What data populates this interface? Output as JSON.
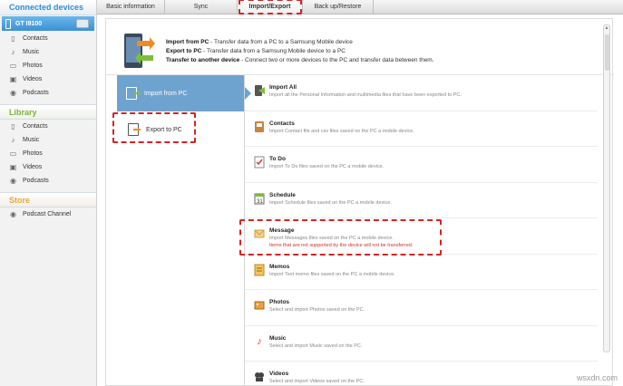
{
  "sidebar": {
    "connected_header": "Connected devices",
    "device_name": "GT I9100",
    "connected_items": [
      {
        "label": "Contacts",
        "icon": "contacts-icon"
      },
      {
        "label": "Music",
        "icon": "music-icon"
      },
      {
        "label": "Photos",
        "icon": "photos-icon"
      },
      {
        "label": "Videos",
        "icon": "videos-icon"
      },
      {
        "label": "Podcasts",
        "icon": "podcasts-icon"
      }
    ],
    "library_header": "Library",
    "library_items": [
      {
        "label": "Contacts",
        "icon": "contacts-icon"
      },
      {
        "label": "Music",
        "icon": "music-icon"
      },
      {
        "label": "Photos",
        "icon": "photos-icon"
      },
      {
        "label": "Videos",
        "icon": "videos-icon"
      },
      {
        "label": "Podcasts",
        "icon": "podcasts-icon"
      }
    ],
    "store_header": "Store",
    "store_items": [
      {
        "label": "Podcast Channel",
        "icon": "podcast-channel-icon"
      }
    ]
  },
  "tabs": [
    {
      "label": "Basic information"
    },
    {
      "label": "Sync"
    },
    {
      "label": "Import/Export",
      "active": true
    },
    {
      "label": "Back up/Restore"
    }
  ],
  "info": {
    "import_title": "Import from PC",
    "import_desc": " - Transfer data from a PC to a Samsung Mobile device",
    "export_title": "Export to PC",
    "export_desc": " - Transfer data from a Samsung Mobile device to a PC",
    "transfer_title": "Transfer to another device",
    "transfer_desc": " - Connect two or more devices to the PC and transfer data between them."
  },
  "subnav": {
    "import_label": "Import from PC",
    "export_label": "Export to PC"
  },
  "items": [
    {
      "title": "Import All",
      "desc": "Import all the Personal Information and multimedia files that have been exported to PC.",
      "icon": "import-all-icon"
    },
    {
      "title": "Contacts",
      "desc": "Import Contact file and csv files saved on the PC a mobile device.",
      "icon": "contacts-icon"
    },
    {
      "title": "To Do",
      "desc": "Import To Do files saved on the PC a mobile device.",
      "icon": "todo-icon"
    },
    {
      "title": "Schedule",
      "desc": "Import Schedule files saved on the PC a mobile device.",
      "icon": "calendar-icon"
    },
    {
      "title": "Message",
      "desc": "Import Messages files saved on the PC a mobile device.",
      "warn": "Items that are not supported by the device will not be transferred.",
      "icon": "message-icon"
    },
    {
      "title": "Memos",
      "desc": "Import Text memo files saved on the PC a mobile device.",
      "icon": "memo-icon"
    },
    {
      "title": "Photos",
      "desc": "Select and import Photos saved on the PC.",
      "icon": "photos-icon"
    },
    {
      "title": "Music",
      "desc": "Select and import Music saved on the PC.",
      "icon": "music-icon"
    },
    {
      "title": "Videos",
      "desc": "Select and import Videos saved on the PC.",
      "icon": "videos-icon"
    }
  ],
  "watermark": "wsxdn.com",
  "colors": {
    "accent_blue": "#2f8ed8",
    "library_green": "#7cb342",
    "store_orange": "#e5a73a",
    "highlight_red": "#d32424",
    "subnav_active": "#6fa3cf"
  }
}
